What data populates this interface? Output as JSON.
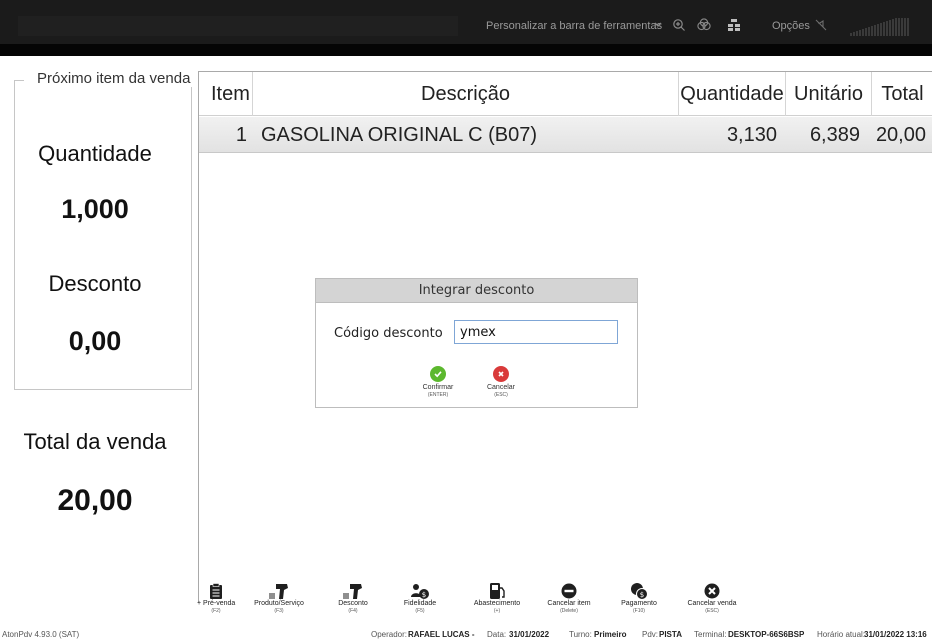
{
  "toolbar": {
    "customize_label": "Personalizar a barra de ferramentas",
    "options_label": "Opções"
  },
  "left_panel": {
    "legend": "Próximo item da venda",
    "quantity_label": "Quantidade",
    "quantity_value": "1,000",
    "discount_label": "Desconto",
    "discount_value": "0,00",
    "total_label": "Total da venda",
    "total_value": "20,00"
  },
  "grid": {
    "headers": [
      "Item",
      "Descrição",
      "Quantidade",
      "Unitário",
      "Total"
    ],
    "rows": [
      {
        "item": "1",
        "description": "GASOLINA ORIGINAL C (B07)",
        "quantity": "3,130",
        "unit": "6,389",
        "total": "20,00"
      }
    ]
  },
  "dialog": {
    "title": "Integrar desconto",
    "field_label": "Código desconto",
    "field_value": "ymex",
    "confirm_label": "Confirmar",
    "confirm_key": "(ENTER)",
    "cancel_label": "Cancelar",
    "cancel_key": "(ESC)"
  },
  "function_bar": [
    {
      "label": "+ Pré-venda",
      "key": "(F2)",
      "icon": "clipboard-icon"
    },
    {
      "label": "Produto/Serviço",
      "key": "(F3)",
      "icon": "barcode-scanner-icon"
    },
    {
      "label": "Desconto",
      "key": "(F4)",
      "icon": "barcode-scanner-icon"
    },
    {
      "label": "Fidelidade",
      "key": "(F5)",
      "icon": "loyalty-icon"
    },
    {
      "label": "Abastecimento",
      "key": "(+)",
      "icon": "fuel-pump-icon"
    },
    {
      "label": "Cancelar item",
      "key": "(Delete)",
      "icon": "minus-circle-icon"
    },
    {
      "label": "Pagamento",
      "key": "(F10)",
      "icon": "payment-icon"
    },
    {
      "label": "Cancelar venda",
      "key": "(ESC)",
      "icon": "x-circle-icon"
    }
  ],
  "status_bar": {
    "version": "AtonPdv 4.93.0 (SAT)",
    "operator_label": "Operador:",
    "operator": "RAFAEL LUCAS -",
    "date_label": "Data:",
    "date": "31/01/2022",
    "shift_label": "Turno:",
    "shift": "Primeiro",
    "pdv_label": "Pdv:",
    "pdv": "PISTA",
    "terminal_label": "Terminal:",
    "terminal": "DESKTOP-66S6BSP",
    "time_label": "Horário atual:",
    "time": "31/01/2022 13:16"
  },
  "colors": {
    "topbar": "#1b1b1b",
    "row_highlight": "#e8e8e8",
    "dialog_title_bg": "#d4d4d4",
    "confirm_green": "#5cb82e",
    "cancel_red": "#d93a3a"
  }
}
